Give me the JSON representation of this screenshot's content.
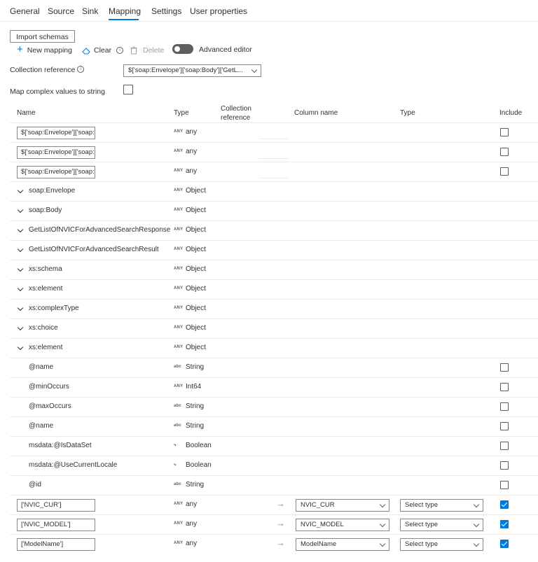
{
  "tabs": [
    {
      "label": "General"
    },
    {
      "label": "Source"
    },
    {
      "label": "Sink"
    },
    {
      "label": "Mapping"
    },
    {
      "label": "Settings"
    },
    {
      "label": "User properties"
    }
  ],
  "active_tab": "Mapping",
  "toolbar": {
    "import_schemas": "Import schemas",
    "new_mapping": "New mapping",
    "clear": "Clear",
    "delete": "Delete",
    "advanced_editor": "Advanced editor"
  },
  "collection_reference": {
    "label": "Collection reference",
    "value": "$['soap:Envelope']['soap:Body']['GetL..."
  },
  "map_complex": {
    "label": "Map complex values to string",
    "checked": false
  },
  "table": {
    "headers": {
      "name": "Name",
      "type": "Type",
      "collection_reference_1": "Collection",
      "collection_reference_2": "reference",
      "column_name": "Column name",
      "sink_type": "Type",
      "include": "Include"
    },
    "rows": [
      {
        "kind": "input",
        "name": "$['soap:Envelope']['soap:",
        "type_icon": "ANY",
        "type": "any",
        "include": false
      },
      {
        "kind": "input",
        "name": "$['soap:Envelope']['soap:",
        "type_icon": "ANY",
        "type": "any",
        "include": false
      },
      {
        "kind": "input",
        "name": "$['soap:Envelope']['soap:",
        "type_icon": "ANY",
        "type": "any",
        "include": false
      },
      {
        "kind": "tree",
        "name": "soap:Envelope",
        "type_icon": "ANY",
        "type": "Object"
      },
      {
        "kind": "tree",
        "name": "soap:Body",
        "type_icon": "ANY",
        "type": "Object"
      },
      {
        "kind": "tree",
        "name": "GetListOfNVICForAdvancedSearchResponse",
        "type_icon": "ANY",
        "type": "Object"
      },
      {
        "kind": "tree",
        "name": "GetListOfNVICForAdvancedSearchResult",
        "type_icon": "ANY",
        "type": "Object"
      },
      {
        "kind": "tree",
        "name": "xs:schema",
        "type_icon": "ANY",
        "type": "Object"
      },
      {
        "kind": "tree",
        "name": "xs:element",
        "type_icon": "ANY",
        "type": "Object"
      },
      {
        "kind": "tree",
        "name": "xs:complexType",
        "type_icon": "ANY",
        "type": "Object"
      },
      {
        "kind": "tree",
        "name": "xs:choice",
        "type_icon": "ANY",
        "type": "Object"
      },
      {
        "kind": "tree",
        "name": "xs:element",
        "type_icon": "ANY",
        "type": "Object"
      },
      {
        "kind": "leaf",
        "name": "@name",
        "type_icon": "abc",
        "type": "String",
        "include": false
      },
      {
        "kind": "leaf",
        "name": "@minOccurs",
        "type_icon": "ANY",
        "type": "Int64",
        "include": false
      },
      {
        "kind": "leaf",
        "name": "@maxOccurs",
        "type_icon": "abc",
        "type": "String",
        "include": false
      },
      {
        "kind": "leaf",
        "name": "@name",
        "type_icon": "abc",
        "type": "String",
        "include": false
      },
      {
        "kind": "leaf",
        "name": "msdata:@IsDataSet",
        "type_icon": "⤷",
        "type": "Boolean",
        "include": false
      },
      {
        "kind": "leaf",
        "name": "msdata:@UseCurrentLocale",
        "type_icon": "⤷",
        "type": "Boolean",
        "include": false
      },
      {
        "kind": "leaf",
        "name": "@id",
        "type_icon": "abc",
        "type": "String",
        "include": false
      },
      {
        "kind": "mapped",
        "name": "['NVIC_CUR']",
        "type_icon": "ANY",
        "type": "any",
        "column": "NVIC_CUR",
        "sink_type": "Select type",
        "include": true
      },
      {
        "kind": "mapped",
        "name": "['NVIC_MODEL']",
        "type_icon": "ANY",
        "type": "any",
        "column": "NVIC_MODEL",
        "sink_type": "Select type",
        "include": true
      },
      {
        "kind": "mapped",
        "name": "['ModelName']",
        "type_icon": "ANY",
        "type": "any",
        "column": "ModelName",
        "sink_type": "Select type",
        "include": true
      }
    ]
  },
  "colors": {
    "accent": "#0078d4",
    "border": "#8a8886",
    "divider": "#edebe9",
    "text": "#323130"
  }
}
